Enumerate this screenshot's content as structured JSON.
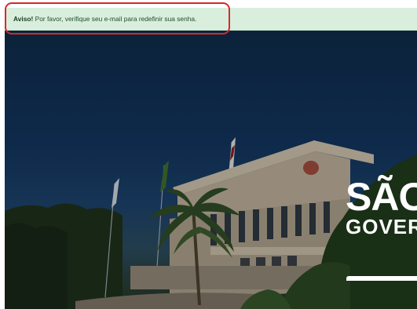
{
  "alert": {
    "strong": "Aviso!",
    "message": " Por favor, verifique seu e-mail para redefinir sua senha."
  },
  "brand": {
    "line1": "SÃO",
    "line2": "GOVER"
  },
  "colors": {
    "alert_bg": "#d9eedd",
    "alert_text": "#1f4d2c",
    "highlight_ring": "#d42a2a",
    "sky": "#0f2a48"
  }
}
